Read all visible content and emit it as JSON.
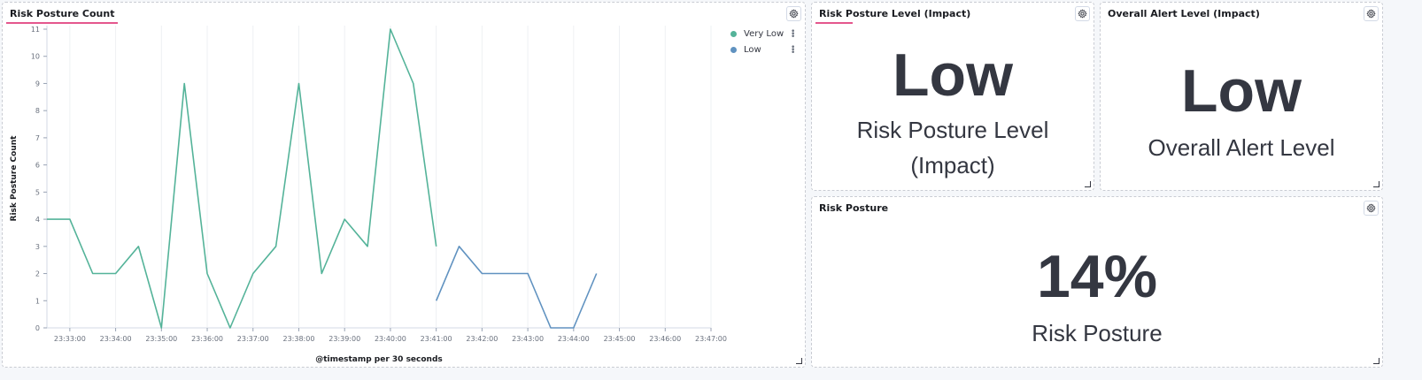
{
  "panels": {
    "risk_count": {
      "title": "Risk Posture Count",
      "legend": [
        {
          "label": "Very Low",
          "color": "#54b399"
        },
        {
          "label": "Low",
          "color": "#6092c0"
        }
      ]
    },
    "risk_level": {
      "title": "Risk Posture Level (Impact)",
      "value": "Low",
      "label_line1": "Risk Posture Level",
      "label_line2": "(Impact)"
    },
    "alert_level": {
      "title": "Overall Alert Level (Impact)",
      "value": "Low",
      "label": "Overall Alert Level"
    },
    "risk_posture": {
      "title": "Risk Posture",
      "value": "14%",
      "label": "Risk Posture"
    }
  },
  "colors": {
    "accent_underline": "#e4578d",
    "very_low": "#54b399",
    "low": "#6092c0",
    "text_dark": "#343741"
  },
  "chart_data": {
    "type": "line",
    "xlabel": "@timestamp per 30 seconds",
    "ylabel": "Risk Posture Count",
    "ylim": [
      0,
      11
    ],
    "yticks": [
      0,
      1,
      2,
      3,
      4,
      5,
      6,
      7,
      8,
      9,
      10,
      11
    ],
    "x_ticks": [
      "23:33:00",
      "23:34:00",
      "23:35:00",
      "23:36:00",
      "23:37:00",
      "23:38:00",
      "23:39:00",
      "23:40:00",
      "23:41:00",
      "23:42:00",
      "23:43:00",
      "23:44:00",
      "23:45:00",
      "23:46:00",
      "23:47:00"
    ],
    "grid": "vertical",
    "legend_position": "top-right",
    "series": [
      {
        "name": "Very Low",
        "color": "#54b399",
        "points": [
          [
            "23:32:30",
            4
          ],
          [
            "23:33:00",
            4
          ],
          [
            "23:33:30",
            2
          ],
          [
            "23:34:00",
            2
          ],
          [
            "23:34:30",
            3
          ],
          [
            "23:35:00",
            0
          ],
          [
            "23:35:30",
            9
          ],
          [
            "23:36:00",
            2
          ],
          [
            "23:36:30",
            0
          ],
          [
            "23:37:00",
            2
          ],
          [
            "23:37:30",
            3
          ],
          [
            "23:38:00",
            9
          ],
          [
            "23:38:30",
            2
          ],
          [
            "23:39:00",
            4
          ],
          [
            "23:39:30",
            3
          ],
          [
            "23:40:00",
            11
          ],
          [
            "23:40:30",
            9
          ],
          [
            "23:41:00",
            3
          ]
        ]
      },
      {
        "name": "Low",
        "color": "#6092c0",
        "points": [
          [
            "23:41:00",
            1
          ],
          [
            "23:41:30",
            3
          ],
          [
            "23:42:00",
            2
          ],
          [
            "23:42:30",
            2
          ],
          [
            "23:43:00",
            2
          ],
          [
            "23:43:30",
            0
          ],
          [
            "23:44:00",
            0
          ],
          [
            "23:44:30",
            2
          ]
        ]
      }
    ]
  }
}
